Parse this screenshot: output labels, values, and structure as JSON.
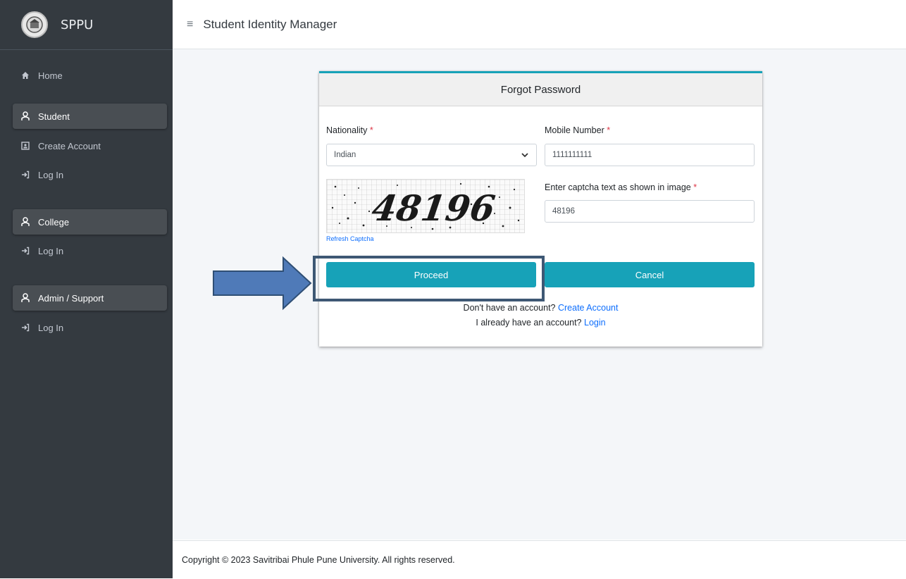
{
  "sidebar": {
    "brand": "SPPU",
    "items": [
      {
        "label": "Home",
        "icon": "home-icon"
      },
      {
        "label": "Student",
        "icon": "user-icon"
      },
      {
        "label": "Create Account",
        "icon": "id-card-icon"
      },
      {
        "label": "Log In",
        "icon": "sign-in-icon"
      },
      {
        "label": "College",
        "icon": "user-icon"
      },
      {
        "label": "Log In",
        "icon": "sign-in-icon"
      },
      {
        "label": "Admin / Support",
        "icon": "user-icon"
      },
      {
        "label": "Log In",
        "icon": "sign-in-icon"
      }
    ]
  },
  "topbar": {
    "menu_icon": "≡",
    "title": "Student Identity Manager"
  },
  "form": {
    "title": "Forgot Password",
    "nationality_label": "Nationality",
    "nationality_value": "Indian",
    "mobile_label": "Mobile Number",
    "mobile_value": "1111111111",
    "captcha_label": "Enter captcha text as shown in image",
    "captcha_value": "48196",
    "captcha_image_text": "48196",
    "refresh_label": "Refresh Captcha",
    "proceed_label": "Proceed",
    "cancel_label": "Cancel",
    "no_account_text": "Don't have an account?",
    "create_account_link": "Create Account",
    "have_account_text": "I already have an account?",
    "login_link": "Login",
    "required_mark": "*"
  },
  "footer": {
    "copyright": "Copyright © 2023 Savitribai Phule Pune University. All rights reserved."
  },
  "colors": {
    "accent": "#17a2b8",
    "sidebar_bg": "#343a40",
    "link": "#0d6efd",
    "highlight": "#3e5874",
    "arrow": "#4f7ab8"
  }
}
